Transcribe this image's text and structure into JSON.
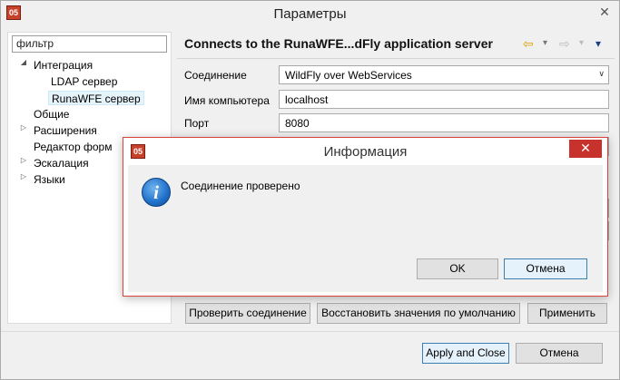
{
  "window": {
    "title": "Параметры",
    "close_glyph": "✕",
    "icon_text": "05"
  },
  "sidebar": {
    "filter_value": "фильтр",
    "items": [
      {
        "label": "Интеграция",
        "arrow": "◢"
      },
      {
        "label": "LDAP сервер"
      },
      {
        "label": "RunaWFE сервер"
      },
      {
        "label": "Общие"
      },
      {
        "label": "Расширения",
        "arrow": "▷"
      },
      {
        "label": "Редактор форм"
      },
      {
        "label": "Эскалация",
        "arrow": "▷"
      },
      {
        "label": "Языки",
        "arrow": "▷"
      }
    ]
  },
  "panel": {
    "title": "Connects to the RunaWFE...dFly application server",
    "nav": {
      "back": "⇦",
      "forward": "⇨",
      "menu1": "▾",
      "menu2": "▾"
    },
    "fields": {
      "connection_label": "Соединение",
      "connection_value": "WildFly over WebServices",
      "host_label": "Имя компьютера",
      "host_value": "localhost",
      "port_label": "Порт",
      "port_value": "8080"
    },
    "buttons": {
      "check": "Проверить соединение",
      "restore": "Восстановить значения по умолчанию",
      "apply": "Применить"
    }
  },
  "footer": {
    "apply_close": "Apply and Close",
    "cancel": "Отмена"
  },
  "dialog": {
    "title": "Информация",
    "icon_text": "05",
    "close_glyph": "✕",
    "info_glyph": "i",
    "message": "Соединение проверено",
    "ok": "OK",
    "cancel": "Отмена"
  },
  "colors": {
    "dialog_border": "#d9433c",
    "close_red": "#c7332c",
    "default_button_border": "#3c7fb1"
  }
}
